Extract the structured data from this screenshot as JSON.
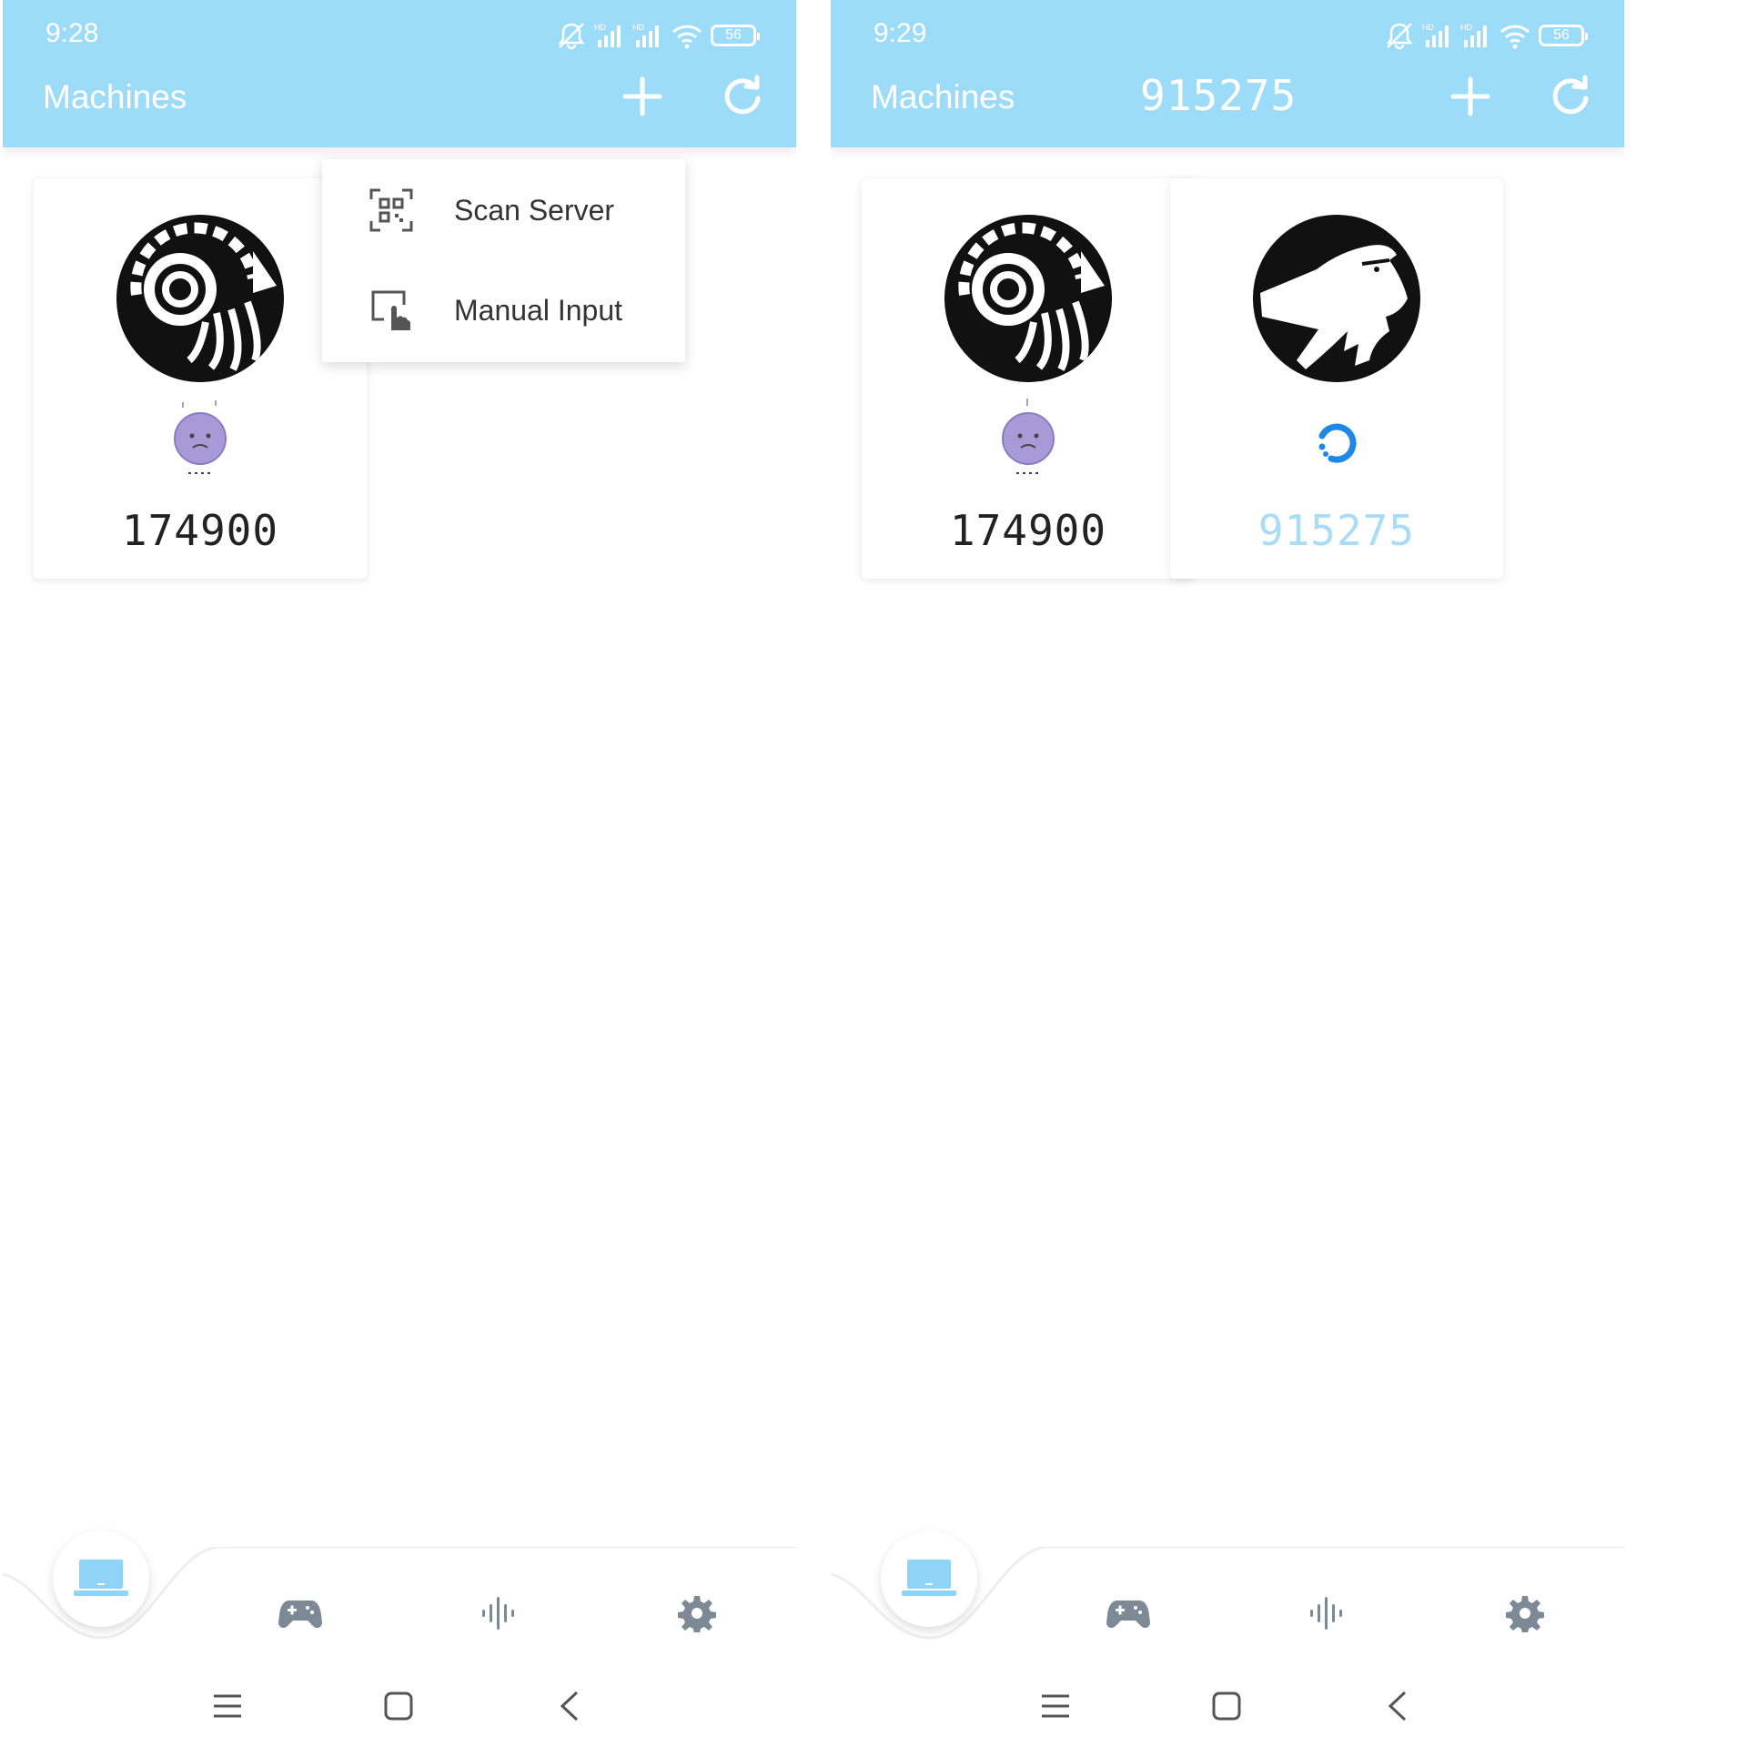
{
  "screens": [
    {
      "status_time": "9:28",
      "battery_level": "56",
      "title": "Machines",
      "header_code": "",
      "machines": [
        {
          "id": "174900",
          "status": "offline",
          "avatar": "ram-octopus-logo"
        }
      ],
      "menu": {
        "visible": true,
        "items": [
          {
            "label": "Scan Server",
            "icon": "qr-scan-icon"
          },
          {
            "label": "Manual Input",
            "icon": "tap-hand-icon"
          }
        ]
      }
    },
    {
      "status_time": "9:29",
      "battery_level": "56",
      "title": "Machines",
      "header_code": "915275",
      "machines": [
        {
          "id": "174900",
          "status": "offline",
          "avatar": "ram-octopus-logo"
        },
        {
          "id": "915275",
          "status": "connecting",
          "avatar": "goat-logo"
        }
      ],
      "menu": {
        "visible": false,
        "items": []
      }
    }
  ],
  "bottom_nav": {
    "items": [
      "machines-icon",
      "gamepad-icon",
      "audio-wave-icon",
      "settings-gear-icon"
    ],
    "active": "machines-icon"
  },
  "system_nav": [
    "menu-icon",
    "home-icon",
    "back-icon"
  ],
  "colors": {
    "appbar": "#9ddcf8",
    "accent": "#1e88e5",
    "connecting_text": "#a9dcf6",
    "nav_icon": "#7d8a95"
  }
}
